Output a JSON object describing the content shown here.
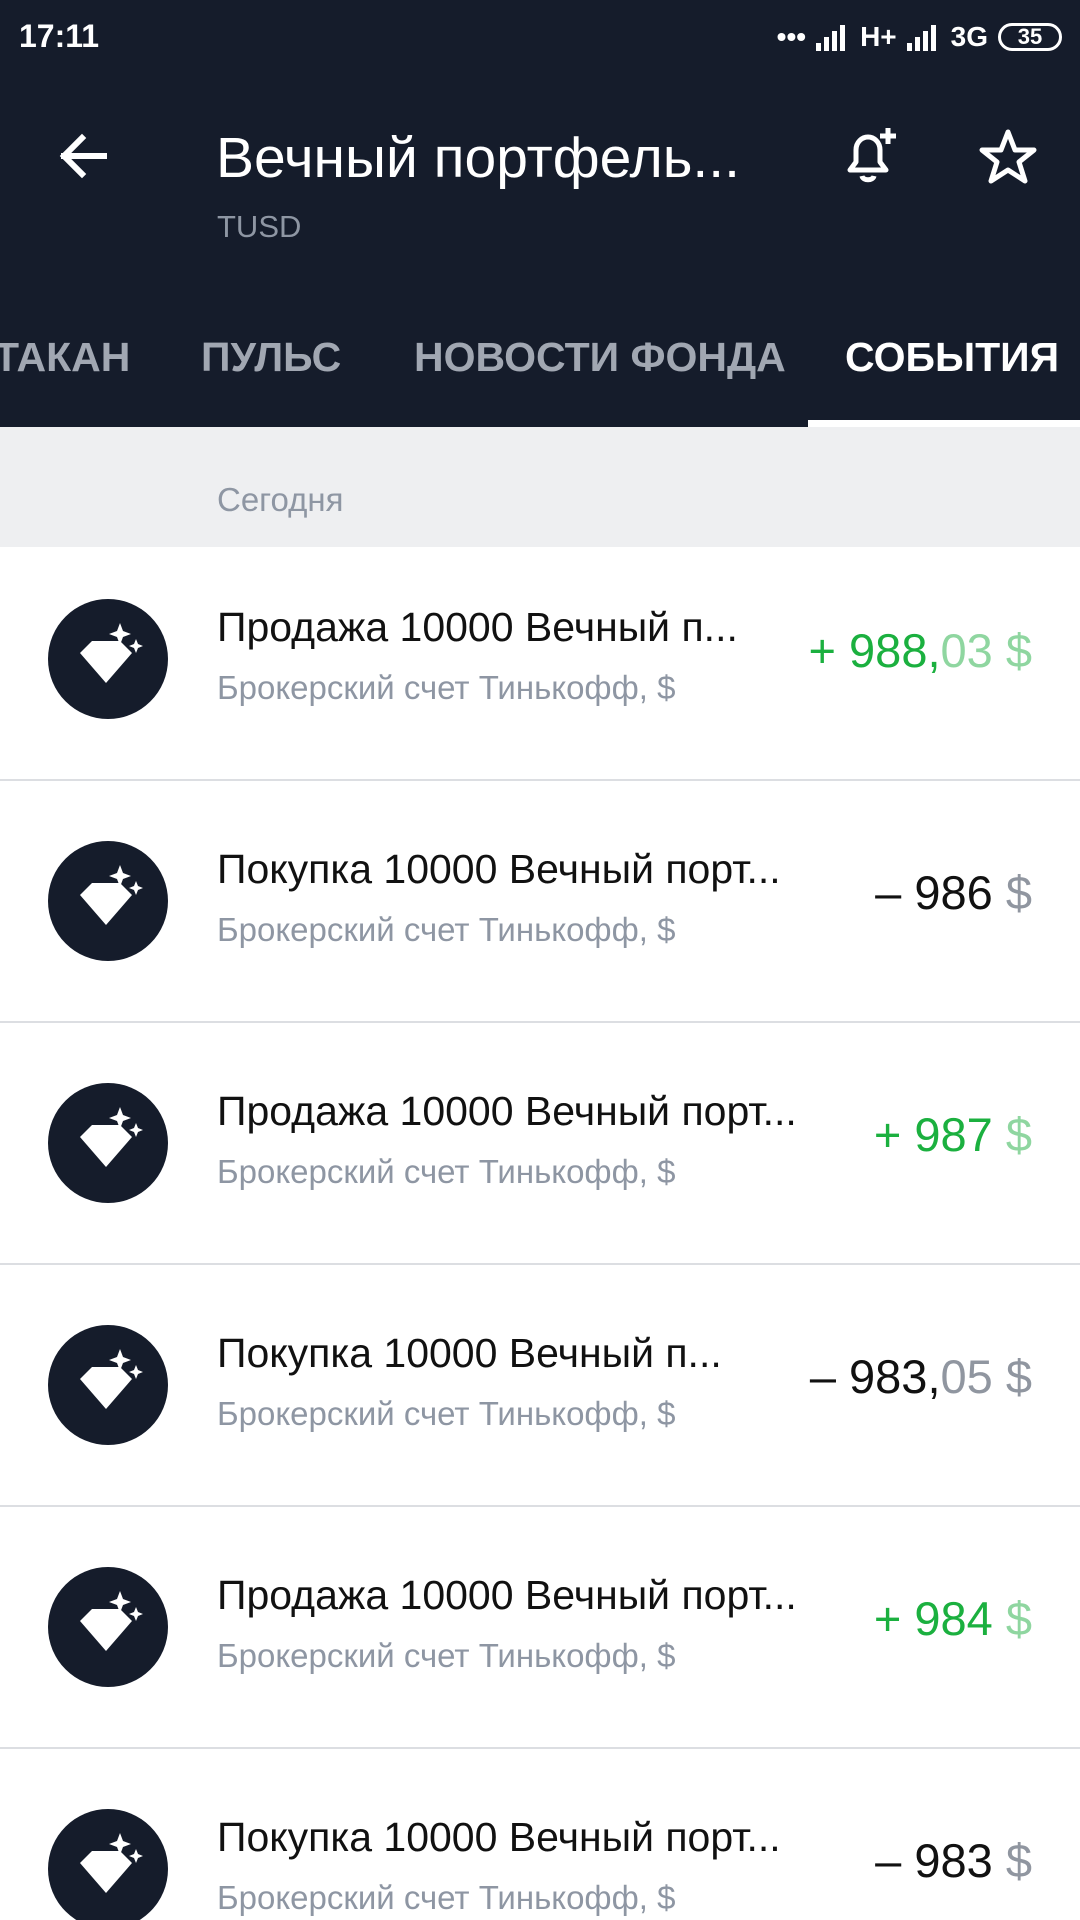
{
  "status_bar": {
    "time": "17:11",
    "network_1": "H+",
    "network_2": "3G",
    "battery": "35"
  },
  "header": {
    "title": "Вечный портфель...",
    "ticker": "TUSD"
  },
  "tabs": [
    {
      "label": "ТАКАН",
      "active": false
    },
    {
      "label": "ПУЛЬС",
      "active": false
    },
    {
      "label": "НОВОСТИ ФОНДА",
      "active": false
    },
    {
      "label": "СОБЫТИЯ",
      "active": true
    }
  ],
  "date_group": "Сегодня",
  "events": [
    {
      "title": "Продажа 10000 Вечный п...",
      "account": "Брокерский счет Тинькофф, $",
      "amount_main": "+ 988,",
      "amount_fraction": "03",
      "currency": " $",
      "type": "positive"
    },
    {
      "title": "Покупка 10000 Вечный порт...",
      "account": "Брокерский счет Тинькофф, $",
      "amount_main": "– 986",
      "amount_fraction": "",
      "currency": " $",
      "type": "negative"
    },
    {
      "title": "Продажа 10000 Вечный порт...",
      "account": "Брокерский счет Тинькофф, $",
      "amount_main": "+ 987",
      "amount_fraction": "",
      "currency": " $",
      "type": "positive"
    },
    {
      "title": "Покупка 10000 Вечный п...",
      "account": "Брокерский счет Тинькофф, $",
      "amount_main": "– 983,",
      "amount_fraction": "05",
      "currency": " $",
      "type": "negative"
    },
    {
      "title": "Продажа 10000 Вечный порт...",
      "account": "Брокерский счет Тинькофф, $",
      "amount_main": "+ 984",
      "amount_fraction": "",
      "currency": " $",
      "type": "positive"
    },
    {
      "title": "Покупка 10000 Вечный порт...",
      "account": "Брокерский счет Тинькофф, $",
      "amount_main": "– 983",
      "amount_fraction": "",
      "currency": " $",
      "type": "negative"
    }
  ],
  "colors": {
    "header_bg": "#151c2b",
    "positive": "#1bb03f",
    "positive_light": "#8fd6a0",
    "muted": "#8e96a3",
    "divider": "#dcdee2",
    "group_bg": "#eeeff1"
  }
}
